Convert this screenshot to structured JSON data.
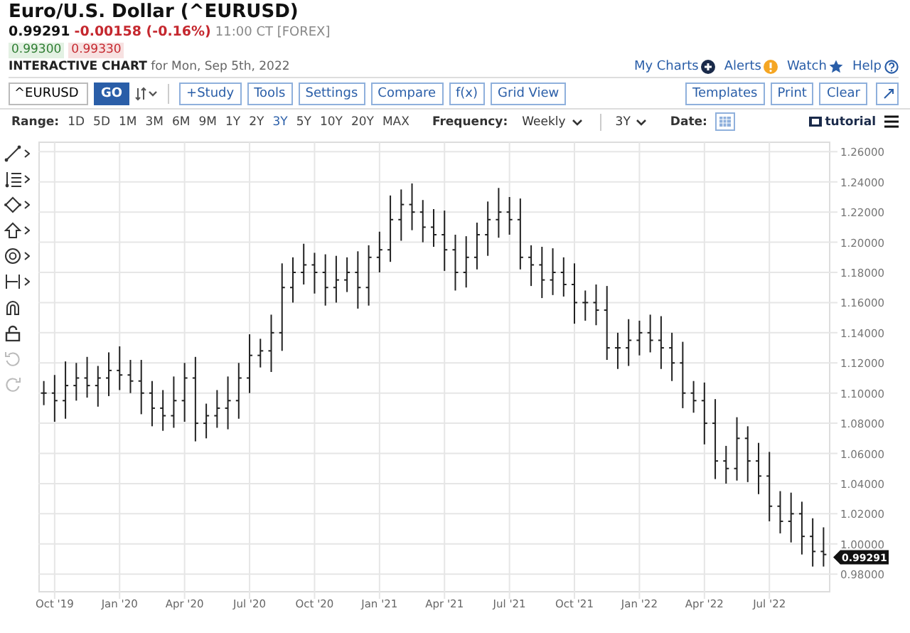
{
  "header": {
    "title": "Euro/U.S. Dollar (^EURUSD)",
    "last": "0.99291",
    "change": "-0.00158 (-0.16%)",
    "time": "11:00 CT [FOREX]",
    "bid": "0.99300",
    "ask": "0.99330",
    "chart_label": "INTERACTIVE CHART",
    "chart_date": "for Mon, Sep 5th, 2022"
  },
  "top_links": [
    {
      "label": "My Charts",
      "kind": "plus"
    },
    {
      "label": "Alerts",
      "kind": "alert"
    },
    {
      "label": "Watch",
      "kind": "star"
    },
    {
      "label": "Help",
      "kind": "help"
    }
  ],
  "toolbar": {
    "symbol": "^EURUSD",
    "go": "GO",
    "buttons": [
      "+Study",
      "Tools",
      "Settings",
      "Compare",
      "f(x)",
      "Grid View"
    ],
    "right_buttons": [
      "Templates",
      "Print",
      "Clear"
    ]
  },
  "range": {
    "label": "Range:",
    "items": [
      {
        "label": "1D",
        "selected": false
      },
      {
        "label": "5D",
        "selected": false
      },
      {
        "label": "1M",
        "selected": false
      },
      {
        "label": "3M",
        "selected": false
      },
      {
        "label": "6M",
        "selected": false
      },
      {
        "label": "9M",
        "selected": false
      },
      {
        "label": "1Y",
        "selected": false
      },
      {
        "label": "2Y",
        "selected": false
      },
      {
        "label": "3Y",
        "selected": true
      },
      {
        "label": "5Y",
        "selected": false
      },
      {
        "label": "10Y",
        "selected": false
      },
      {
        "label": "20Y",
        "selected": false
      },
      {
        "label": "MAX",
        "selected": false
      }
    ],
    "frequency_label": "Frequency:",
    "frequency": "Weekly",
    "period": "3Y",
    "date_label": "Date:",
    "tutorial": "tutorial"
  },
  "tools": [
    {
      "kind": "line",
      "has_menu": true,
      "disabled": false
    },
    {
      "kind": "fib",
      "has_menu": true,
      "disabled": false
    },
    {
      "kind": "diamond",
      "has_menu": true,
      "disabled": false
    },
    {
      "kind": "arrow",
      "has_menu": true,
      "disabled": false
    },
    {
      "kind": "target",
      "has_menu": true,
      "disabled": false
    },
    {
      "kind": "measure",
      "has_menu": true,
      "disabled": false
    },
    {
      "kind": "magnet",
      "has_menu": false,
      "disabled": false
    },
    {
      "kind": "lock",
      "has_menu": false,
      "disabled": false
    },
    {
      "kind": "undo",
      "has_menu": false,
      "disabled": true
    },
    {
      "kind": "redo",
      "has_menu": false,
      "disabled": true
    }
  ],
  "chart": {
    "last_badge": "0.99291",
    "y_labels": [
      "1.26000",
      "1.24000",
      "1.22000",
      "1.20000",
      "1.18000",
      "1.16000",
      "1.14000",
      "1.12000",
      "1.10000",
      "1.08000",
      "1.06000",
      "1.04000",
      "1.02000",
      "1.00000",
      "0.98000"
    ],
    "x_labels": [
      "Oct '19",
      "Jan '20",
      "Apr '20",
      "Jul '20",
      "Oct '20",
      "Jan '21",
      "Apr '21",
      "Jul '21",
      "Oct '21",
      "Jan '22",
      "Apr '22",
      "Jul '22"
    ]
  }
}
